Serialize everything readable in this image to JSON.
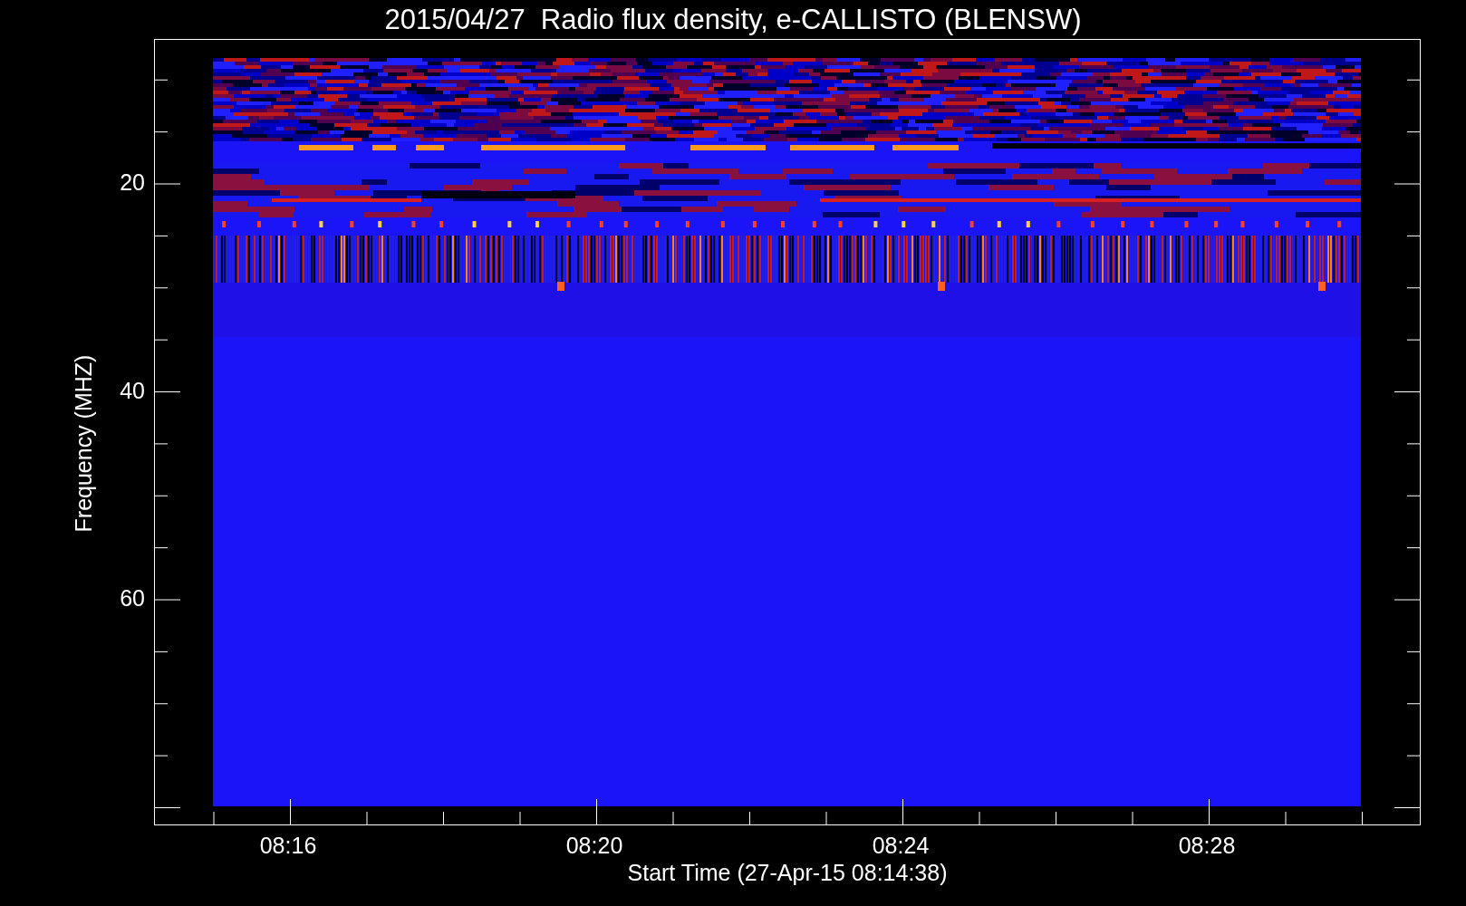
{
  "title": "2015/04/27  Radio flux density, e-CALLISTO (BLENSW)",
  "y_axis": {
    "label": "Frequency (MHZ)",
    "ticks": [
      "20",
      "40",
      "60"
    ]
  },
  "x_axis": {
    "label": "Start Time (27-Apr-15 08:14:38)",
    "ticks": [
      "08:16",
      "08:20",
      "08:24",
      "08:28"
    ]
  }
}
